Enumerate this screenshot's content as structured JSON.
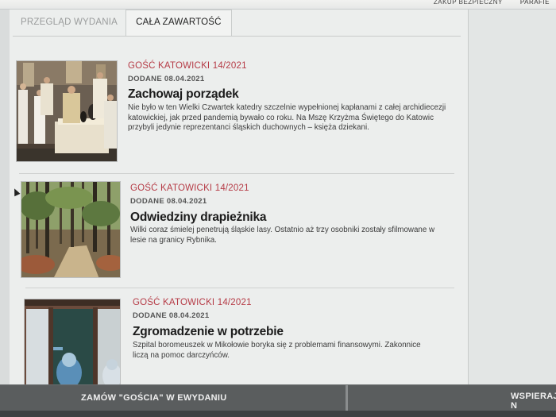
{
  "top_nav": {
    "items": [
      "ZAKUP BEZPIECZNY",
      "PARAFIE"
    ]
  },
  "tabs": [
    {
      "label": "PRZEGLĄD WYDANIA",
      "active": false
    },
    {
      "label": "CAŁA ZAWARTOŚĆ",
      "active": true
    }
  ],
  "articles": [
    {
      "source": "GOŚĆ KATOWICKI 14/2021",
      "date": "DODANE 08.04.2021",
      "title": "Zachowaj porządek",
      "lead": "Nie było w ten Wielki Czwartek katedry szczelnie wypełnionej kapłanami z całej archidiecezji katowickiej, jak przed pandemią bywało co roku. Na Mszę Krzyżma Świętego do Katowic przybyli jedynie reprezentanci śląskich duchownych – księża dziekani."
    },
    {
      "source": "GOŚĆ KATOWICKI 14/2021",
      "date": "DODANE 08.04.2021",
      "title": "Odwiedziny drapieżnika",
      "lead": "Wilki coraz śmielej penetrują śląskie lasy. Ostatnio aż trzy osobniki zostały sfilmowane w lesie na granicy Rybnika."
    },
    {
      "source": "GOŚĆ KATOWICKI 14/2021",
      "date": "DODANE 08.04.2021",
      "title": "Zgromadzenie w potrzebie",
      "lead": "Szpital boromeuszek w Mikołowie boryka się z problemami finansowymi. Zakonnice liczą na pomoc darczyńców."
    }
  ],
  "bottom_bar": {
    "left_label": "ZAMÓW \"GOŚCIA\" W EWYDANIU",
    "right_label": "WSPIERAJ N"
  }
}
